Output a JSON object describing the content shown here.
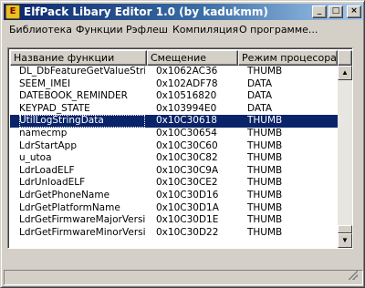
{
  "window": {
    "title": "ElfPack Libary Editor 1.0   (by kadukmm)",
    "icon": "elf-app-icon",
    "controls": {
      "minimize": "_",
      "maximize": "□",
      "close": "×"
    }
  },
  "menu": {
    "items": [
      {
        "label": "Библиотека"
      },
      {
        "label": "Функции"
      },
      {
        "label": "Рэфлеш"
      },
      {
        "label": "Компиляция"
      },
      {
        "label": "О программе..."
      }
    ]
  },
  "table": {
    "columns": [
      {
        "label": "Название функции"
      },
      {
        "label": "Смещение"
      },
      {
        "label": "Режим процесора*"
      }
    ],
    "selected_index": 5,
    "rows": [
      {
        "name": "DL_DbFeatureGetValueString",
        "offset": "0x1062AC36",
        "mode": "THUMB"
      },
      {
        "name": "SEEM_IMEI",
        "offset": "0x102ADF78",
        "mode": "DATA"
      },
      {
        "name": "DATEBOOK_REMINDER",
        "offset": "0x10516820",
        "mode": "DATA"
      },
      {
        "name": "KEYPAD_STATE",
        "offset": "0x103994E0",
        "mode": "DATA"
      },
      {
        "name": "UtilLogStringData",
        "offset": "0x10C30618",
        "mode": "THUMB"
      },
      {
        "name": "namecmp",
        "offset": "0x10C30654",
        "mode": "THUMB"
      },
      {
        "name": "LdrStartApp",
        "offset": "0x10C30C60",
        "mode": "THUMB"
      },
      {
        "name": "u_utoa",
        "offset": "0x10C30C82",
        "mode": "THUMB"
      },
      {
        "name": "LdrLoadELF",
        "offset": "0x10C30C9A",
        "mode": "THUMB"
      },
      {
        "name": "LdrUnloadELF",
        "offset": "0x10C30CE2",
        "mode": "THUMB"
      },
      {
        "name": "LdrGetPhoneName",
        "offset": "0x10C30D16",
        "mode": "THUMB"
      },
      {
        "name": "LdrGetPlatformName",
        "offset": "0x10C30D1A",
        "mode": "THUMB"
      },
      {
        "name": "LdrGetFirmwareMajorVersion",
        "offset": "0x10C30D1E",
        "mode": "THUMB"
      },
      {
        "name": "LdrGetFirmwareMinorVersion",
        "offset": "0x10C30D22",
        "mode": "THUMB"
      }
    ]
  },
  "scrollbar": {
    "up_arrow": "▲",
    "down_arrow": "▼",
    "position": 0.92
  },
  "status": {
    "text": ""
  },
  "colors": {
    "title_active": "#0a246a",
    "selection": "#0a246a",
    "face": "#d4d0c8"
  }
}
